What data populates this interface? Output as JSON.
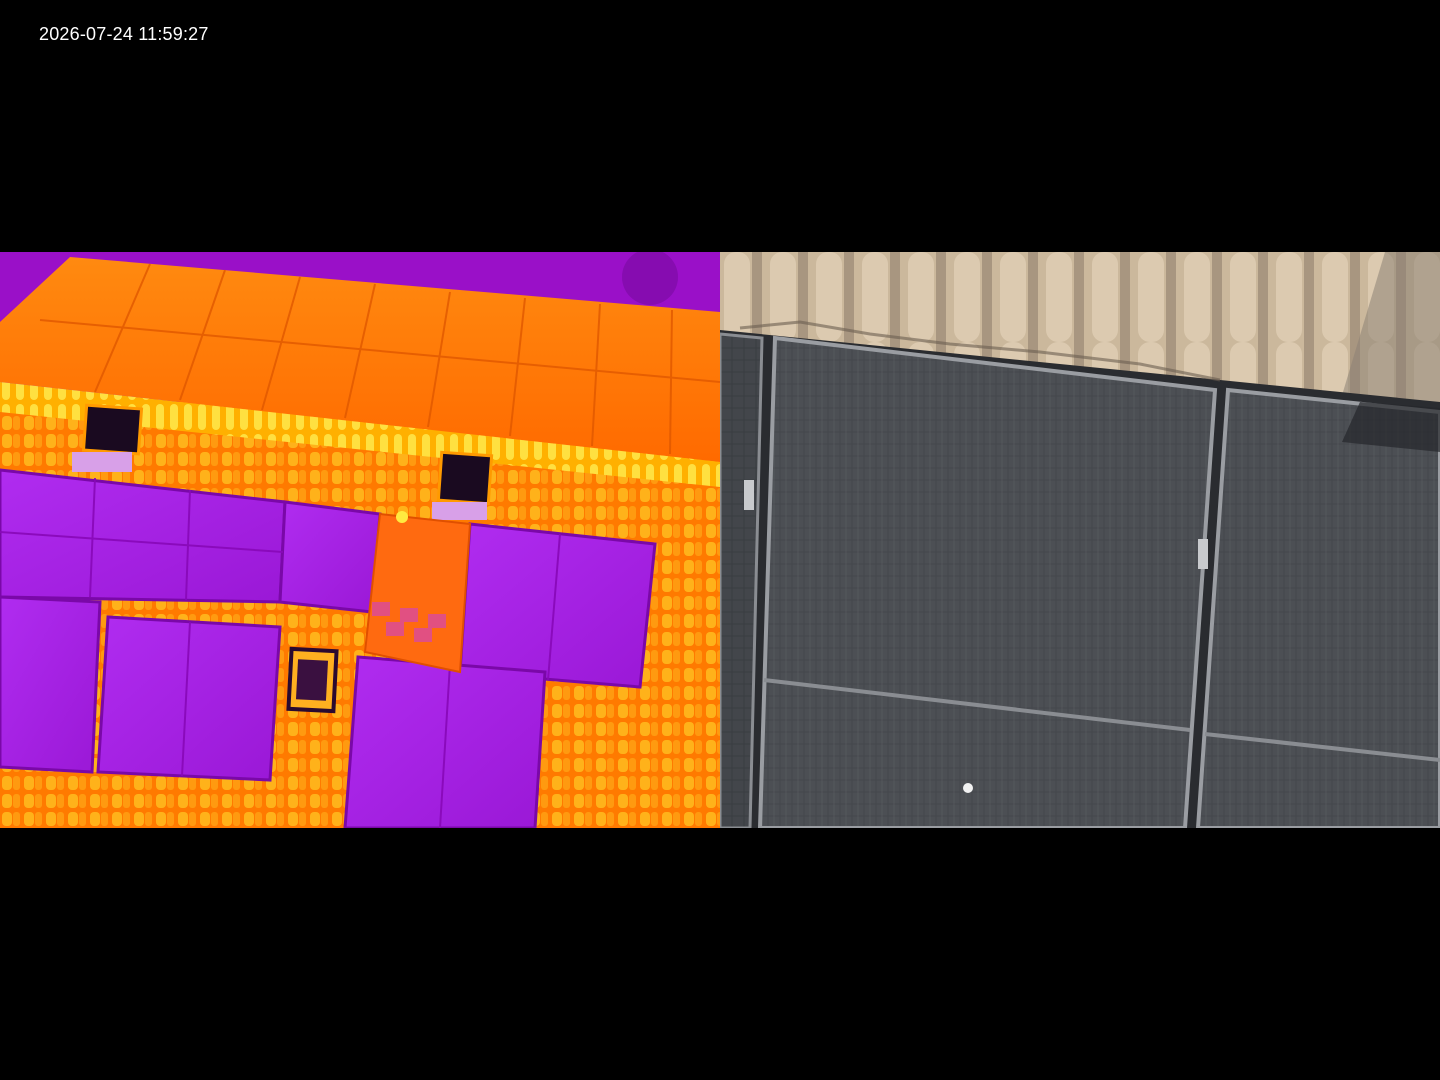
{
  "overlay": {
    "timestamp": "2026-07-24 11:59:27"
  },
  "feeds": {
    "thermal": {
      "icon": "thermal-camera-view",
      "palette": [
        "#8a00b8",
        "#c21aff",
        "#ff5a00",
        "#ff8a00",
        "#ffd21a"
      ]
    },
    "visual": {
      "icon": "rgb-camera-view",
      "palette": [
        "#4b4f55",
        "#2f3237",
        "#cbb89c",
        "#9e9080"
      ]
    }
  }
}
